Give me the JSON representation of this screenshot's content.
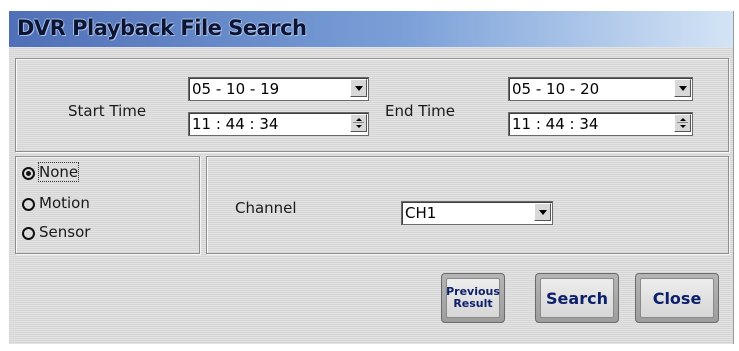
{
  "window": {
    "title": "DVR Playback File Search"
  },
  "time": {
    "start_label": "Start Time",
    "start_date": "05 - 10 - 19",
    "start_time": "11 : 44 : 34",
    "end_label": "End Time",
    "end_date": "05 - 10 - 20",
    "end_time": "11 : 44 : 34"
  },
  "event_type": {
    "options": [
      "None",
      "Motion",
      "Sensor"
    ],
    "selected": "None"
  },
  "channel": {
    "label": "Channel",
    "value": "CH1"
  },
  "buttons": {
    "previous_result": "Previous Result",
    "search": "Search",
    "close": "Close"
  },
  "colors": {
    "title_bar_start": "#4f6fb7",
    "title_bar_end": "#d4e4f6",
    "button_text": "#0c1f6a"
  }
}
